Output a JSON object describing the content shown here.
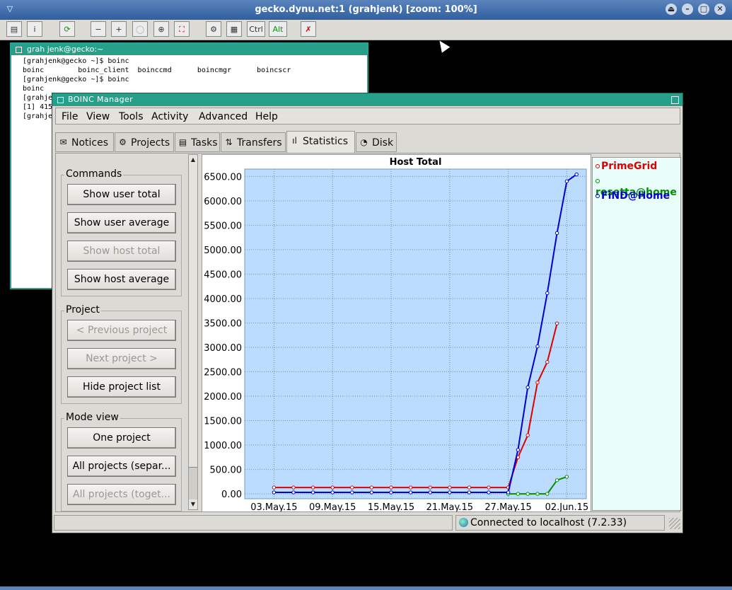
{
  "vnc": {
    "title": "gecko.dynu.net:1 (grahjenk) [zoom: 100%]",
    "toolbar": [
      {
        "icon": "clipboard-icon"
      },
      {
        "icon": "info-icon"
      },
      {
        "icon": "refresh-icon"
      },
      {
        "icon": "zoom-out-icon"
      },
      {
        "icon": "zoom-in-icon"
      },
      {
        "icon": "zoom-reset-icon"
      },
      {
        "icon": "zoom-auto-icon"
      },
      {
        "icon": "fullscreen-icon"
      },
      {
        "icon": "options-icon"
      },
      {
        "icon": "send-keys-icon"
      },
      {
        "label": "Ctrl"
      },
      {
        "label": "Alt"
      },
      {
        "icon": "disconnect-icon"
      }
    ]
  },
  "terminal": {
    "title": "grah jenk@gecko:~",
    "lines": [
      "[grahjenk@gecko ~]$ boinc",
      "boinc        boinc_client  boinccmd      boincmgr      boincscr",
      "[grahjenk@gecko ~]$ boinc",
      "boinc",
      "[grahje",
      "[1] 415",
      "[grahje"
    ]
  },
  "boinc": {
    "title": "BOINC Manager",
    "menu": [
      "File",
      "View",
      "Tools",
      "Activity",
      "Advanced",
      "Help"
    ],
    "tabs": [
      "Notices",
      "Projects",
      "Tasks",
      "Transfers",
      "Statistics",
      "Disk"
    ],
    "active_tab": "Statistics",
    "commands": {
      "label": "Commands",
      "buttons": [
        "Show user total",
        "Show user average",
        "Show host total",
        "Show host average"
      ]
    },
    "project": {
      "label": "Project",
      "buttons": [
        "< Previous project",
        "Next project >",
        "Hide project list"
      ]
    },
    "mode_view": {
      "label": "Mode view",
      "buttons": [
        "One project",
        "All projects (separ...",
        "All projects (toget..."
      ]
    },
    "status": "Connected to localhost (7.2.33)"
  },
  "chart_data": {
    "type": "line",
    "title": "Host Total",
    "xlabel": "",
    "ylabel": "",
    "x_ticks": [
      "03.May.15",
      "09.May.15",
      "15.May.15",
      "21.May.15",
      "27.May.15",
      "02.Jun.15"
    ],
    "y_ticks": [
      "0.00",
      "500.00",
      "1000.00",
      "1500.00",
      "2000.00",
      "2500.00",
      "3000.00",
      "3500.00",
      "4000.00",
      "4500.00",
      "5000.00",
      "5500.00",
      "6000.00",
      "6500.00"
    ],
    "ylim": [
      -100,
      6650
    ],
    "xlim": [
      "2015-04-30",
      "2015-06-04"
    ],
    "grid": true,
    "legend_position": "right",
    "series": [
      {
        "name": "PrimeGrid",
        "color": "#e00000",
        "x": [
          "2015-05-03",
          "2015-05-05",
          "2015-05-07",
          "2015-05-09",
          "2015-05-11",
          "2015-05-13",
          "2015-05-15",
          "2015-05-17",
          "2015-05-19",
          "2015-05-21",
          "2015-05-23",
          "2015-05-25",
          "2015-05-27",
          "2015-05-28",
          "2015-05-29",
          "2015-05-30",
          "2015-05-31",
          "2015-06-01"
        ],
        "y": [
          130,
          130,
          130,
          130,
          130,
          130,
          130,
          130,
          130,
          130,
          130,
          130,
          130,
          750,
          1200,
          2280,
          2700,
          3490
        ]
      },
      {
        "name": "rosetta@home",
        "color": "#009000",
        "x": [
          "2015-05-27",
          "2015-05-28",
          "2015-05-29",
          "2015-05-30",
          "2015-05-31",
          "2015-06-01",
          "2015-06-02"
        ],
        "y": [
          0,
          0,
          0,
          0,
          0,
          280,
          350
        ]
      },
      {
        "name": "FiND@Home",
        "color": "#0000d0",
        "x": [
          "2015-05-03",
          "2015-05-05",
          "2015-05-07",
          "2015-05-09",
          "2015-05-11",
          "2015-05-13",
          "2015-05-15",
          "2015-05-17",
          "2015-05-19",
          "2015-05-21",
          "2015-05-23",
          "2015-05-25",
          "2015-05-27",
          "2015-05-28",
          "2015-05-29",
          "2015-05-30",
          "2015-05-31",
          "2015-06-01",
          "2015-06-02",
          "2015-06-03"
        ],
        "y": [
          30,
          30,
          30,
          30,
          30,
          30,
          30,
          30,
          30,
          30,
          30,
          30,
          30,
          900,
          2180,
          3020,
          4110,
          5340,
          6400,
          6540
        ]
      }
    ]
  }
}
